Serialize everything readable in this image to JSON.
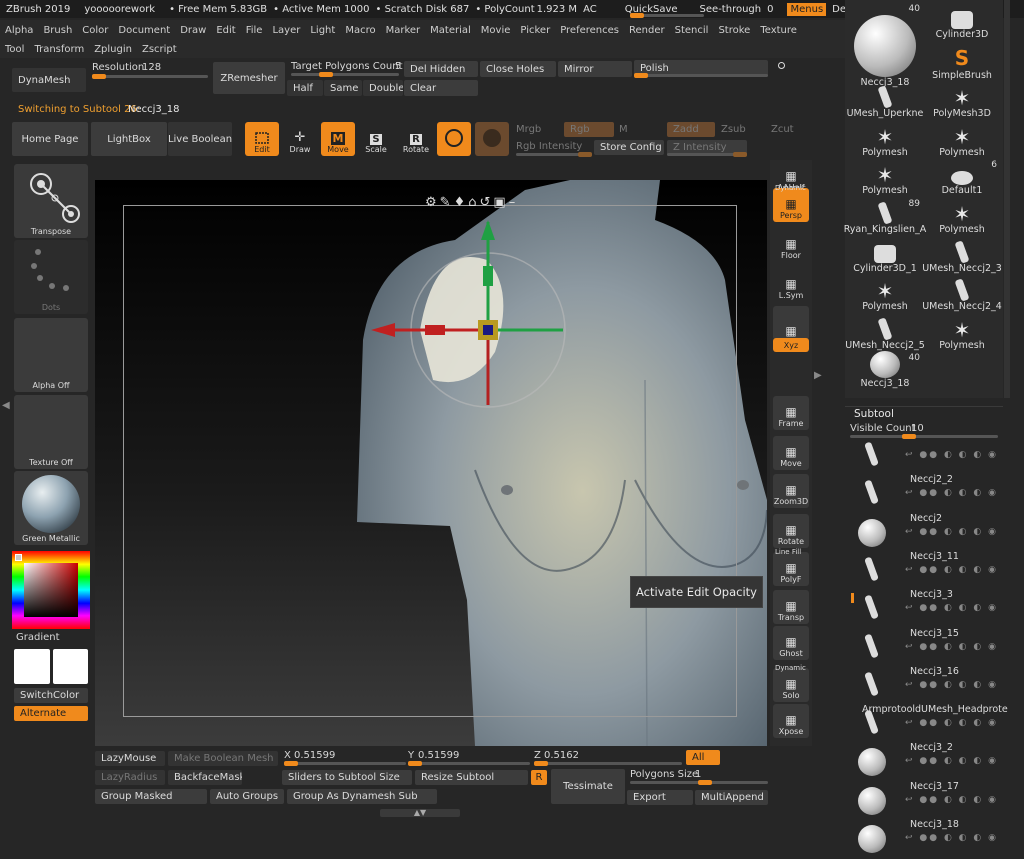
{
  "titlebar": {
    "app": "ZBrush 2019",
    "doc": "yooooorework",
    "free_mem": "• Free Mem 5.83GB",
    "active_mem": "• Active Mem 1000",
    "scratch": "• Scratch Disk 687",
    "polycount": "• PolyCount",
    "poly_val": "1.923 M",
    "ac": "AC",
    "quicksave": "QuickSave",
    "seethrough": "See-through",
    "seethrough_val": "0",
    "menus": "Menus",
    "script": "DefaultZScript"
  },
  "menus": [
    "Alpha",
    "Brush",
    "Color",
    "Document",
    "Draw",
    "Edit",
    "File",
    "Layer",
    "Light",
    "Macro",
    "Marker",
    "Material",
    "Movie",
    "Picker",
    "Preferences",
    "Render",
    "Stencil",
    "Stroke",
    "Texture"
  ],
  "menus2": [
    "Tool",
    "Transform",
    "Zplugin",
    "Zscript"
  ],
  "dynamesh": {
    "label": "DynaMesh",
    "resolution": "Resolution",
    "resolution_val": "128",
    "zremesher": "ZRemesher",
    "target": "Target Polygons Count",
    "target_val": "5",
    "half": "Half",
    "same": "Same",
    "double": "Double",
    "del_hidden": "Del Hidden",
    "clear": "Clear",
    "close_holes": "Close Holes",
    "mirror": "Mirror",
    "polish": "Polish"
  },
  "status": {
    "switching": "Switching to Subtool 26:",
    "subtool_name": "Neccj3_18"
  },
  "toolbar": {
    "home": "Home Page",
    "lightbox": "LightBox",
    "live_boolean": "Live Boolean",
    "edit": "Edit",
    "draw": "Draw",
    "move": "Move",
    "scale": "Scale",
    "rotate": "Rotate",
    "mrgb": "Mrgb",
    "rgb": "Rgb",
    "m": "M",
    "zadd": "Zadd",
    "zsub": "Zsub",
    "zcut": "Zcut",
    "rgb_intensity": "Rgb Intensity",
    "store_config": "Store Config",
    "z_intensity": "Z Intensity"
  },
  "leftshelf": {
    "transpose": "Transpose",
    "dots": "Dots",
    "alpha_off": "Alpha Off",
    "texture_off": "Texture Off",
    "material": "Green Metallic",
    "gradient": "Gradient",
    "switchcolor": "SwitchColor",
    "alternate": "Alternate"
  },
  "rightshelf": [
    "AAHalf",
    "Persp",
    "Floor",
    "L.Sym",
    "",
    "Xyz",
    "",
    "",
    "Frame",
    "Move",
    "Zoom3D",
    "Rotate",
    "PolyF",
    "Transp",
    "Ghost",
    "Solo",
    "Xpose"
  ],
  "rightshelf_extra": {
    "dynamic": "Dynamic",
    "linefill": "Line Fill",
    "dynamic2": "Dynamic"
  },
  "tooltip": "Activate Edit Opacity",
  "bottombar": {
    "lazymouse": "LazyMouse",
    "make_boolean": "Make Boolean Mesh",
    "x": "X",
    "x_val": "0.51599",
    "y": "Y",
    "y_val": "0.51599",
    "z": "Z",
    "z_val": "0.5162",
    "all": "All",
    "lazyradius": "LazyRadius",
    "backfacemask": "BackfaceMask",
    "sliders": "Sliders to Subtool Size",
    "resize": "Resize Subtool",
    "r": "R",
    "tessimate": "Tessimate",
    "polygons_size": "Polygons Size",
    "polygons_size_val": "1",
    "group_masked": "Group Masked",
    "auto_groups": "Auto Groups",
    "group_dynamesh": "Group As Dynamesh Sub",
    "export": "Export",
    "multiappend": "MultiAppend"
  },
  "toolgrid": [
    {
      "name": "Neccj3_18",
      "kind": "sphere",
      "count": "40"
    },
    {
      "name": "Cylinder3D",
      "kind": "cyl",
      "count": ""
    },
    {
      "name": "",
      "kind": "none",
      "count": ""
    },
    {
      "name": "SimpleBrush",
      "kind": "s",
      "count": ""
    },
    {
      "name": "UMesh_Uperkne",
      "kind": "piece",
      "count": ""
    },
    {
      "name": "PolyMesh3D",
      "kind": "star",
      "count": ""
    },
    {
      "name": "Polymesh",
      "kind": "star",
      "count": ""
    },
    {
      "name": "Polymesh",
      "kind": "star",
      "count": ""
    },
    {
      "name": "Polymesh",
      "kind": "star",
      "count": ""
    },
    {
      "name": "Default1",
      "kind": "ring",
      "count": "6"
    },
    {
      "name": "Ryan_Kingslien_A",
      "kind": "piece",
      "count": "89"
    },
    {
      "name": "Polymesh",
      "kind": "star",
      "count": ""
    },
    {
      "name": "Cylinder3D_1",
      "kind": "cyl",
      "count": ""
    },
    {
      "name": "UMesh_Neccj2_3",
      "kind": "piece",
      "count": ""
    },
    {
      "name": "Polymesh",
      "kind": "star",
      "count": ""
    },
    {
      "name": "UMesh_Neccj2_4",
      "kind": "piece",
      "count": ""
    },
    {
      "name": "UMesh_Neccj2_5",
      "kind": "piece",
      "count": ""
    },
    {
      "name": "Polymesh",
      "kind": "star",
      "count": ""
    },
    {
      "name": "Neccj3_18",
      "kind": "sphere",
      "count": "40"
    }
  ],
  "subtool": {
    "title": "Subtool",
    "visible_count": "Visible Count",
    "visible_count_val": "10",
    "items": [
      "",
      "Neccj2_2",
      "Neccj2",
      "Neccj3_11",
      "Neccj3_3",
      "Neccj3_15",
      "Neccj3_16",
      "ArmprotooldUMesh_Headprote",
      "Neccj3_2",
      "Neccj3_17",
      "Neccj3_18"
    ]
  }
}
